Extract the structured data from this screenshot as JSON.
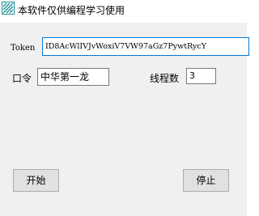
{
  "window": {
    "title": "本软件仅供编程学习使用",
    "icon": "app-logo-icon"
  },
  "form": {
    "token_label": "Token",
    "token_value": "ID8AcWlIVJvWoxiV7VW97aGz7PywtRycY",
    "password_label": "口令",
    "password_value": "中华第一龙",
    "threads_label": "线程数",
    "threads_value": "3"
  },
  "buttons": {
    "start_label": "开始",
    "stop_label": "停止"
  },
  "colors": {
    "client_bg": "#f0f0f0",
    "focus_border": "#0078d7",
    "button_bg": "#e1e1e1",
    "icon_teal": "#1e8c96"
  }
}
